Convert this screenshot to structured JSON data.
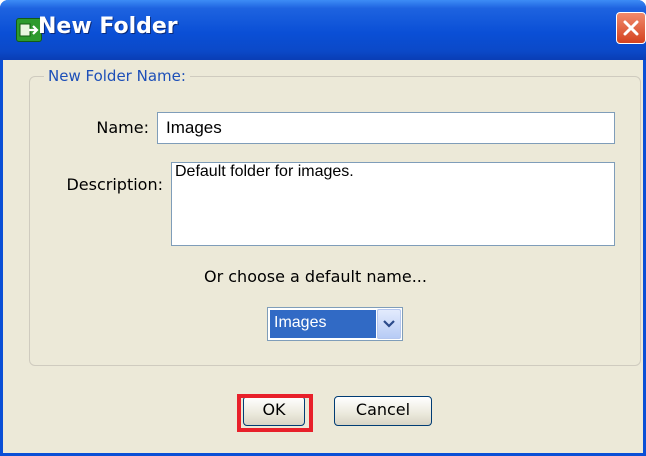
{
  "window": {
    "title": "New Folder",
    "app_icon": "folder-app-icon",
    "close_icon": "close-icon",
    "accent_color": "#0a4fd6"
  },
  "form": {
    "group_legend": "New Folder Name:",
    "name_label": "Name:",
    "name_value": "Images",
    "description_label": "Description:",
    "description_value": "Default folder for images.",
    "default_hint": "Or choose a default name...",
    "default_select_value": "Images",
    "dropdown_icon": "chevron-down-icon"
  },
  "buttons": {
    "ok_label": "OK",
    "cancel_label": "Cancel"
  },
  "annotation": {
    "highlight_color": "#e8202a"
  }
}
